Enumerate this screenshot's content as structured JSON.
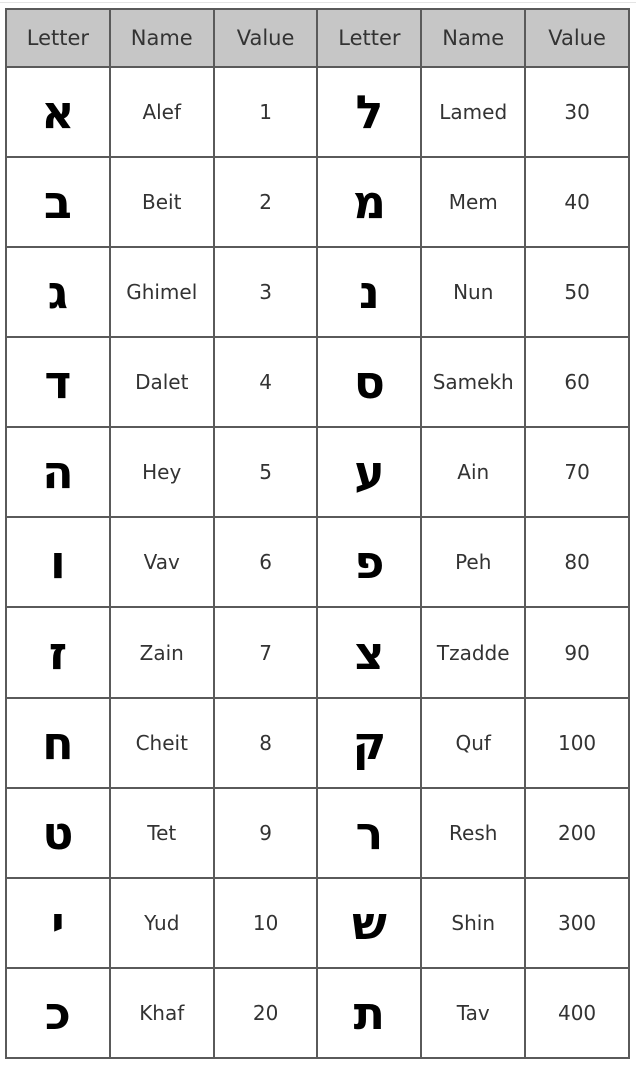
{
  "headers": [
    "Letter",
    "Name",
    "Value",
    "Letter",
    "Name",
    "Value"
  ],
  "rows": [
    {
      "l1": "א",
      "n1": "Alef",
      "v1": "1",
      "l2": "ל",
      "n2": "Lamed",
      "v2": "30"
    },
    {
      "l1": "ב",
      "n1": "Beit",
      "v1": "2",
      "l2": "מ",
      "n2": "Mem",
      "v2": "40"
    },
    {
      "l1": "ג",
      "n1": "Ghimel",
      "v1": "3",
      "l2": "נ",
      "n2": "Nun",
      "v2": "50"
    },
    {
      "l1": "ד",
      "n1": "Dalet",
      "v1": "4",
      "l2": "ס",
      "n2": "Samekh",
      "v2": "60"
    },
    {
      "l1": "ה",
      "n1": "Hey",
      "v1": "5",
      "l2": "ע",
      "n2": "Ain",
      "v2": "70"
    },
    {
      "l1": "ו",
      "n1": "Vav",
      "v1": "6",
      "l2": "פ",
      "n2": "Peh",
      "v2": "80"
    },
    {
      "l1": "ז",
      "n1": "Zain",
      "v1": "7",
      "l2": "צ",
      "n2": "Tzadde",
      "v2": "90"
    },
    {
      "l1": "ח",
      "n1": "Cheit",
      "v1": "8",
      "l2": "ק",
      "n2": "Quf",
      "v2": "100"
    },
    {
      "l1": "ט",
      "n1": "Tet",
      "v1": "9",
      "l2": "ר",
      "n2": "Resh",
      "v2": "200"
    },
    {
      "l1": "י",
      "n1": "Yud",
      "v1": "10",
      "l2": "ש",
      "n2": "Shin",
      "v2": "300"
    },
    {
      "l1": "כ",
      "n1": "Khaf",
      "v1": "20",
      "l2": "ת",
      "n2": "Tav",
      "v2": "400"
    }
  ],
  "colors": {
    "header_bg": "#c6c6c6",
    "border": "#5a5a5a"
  }
}
